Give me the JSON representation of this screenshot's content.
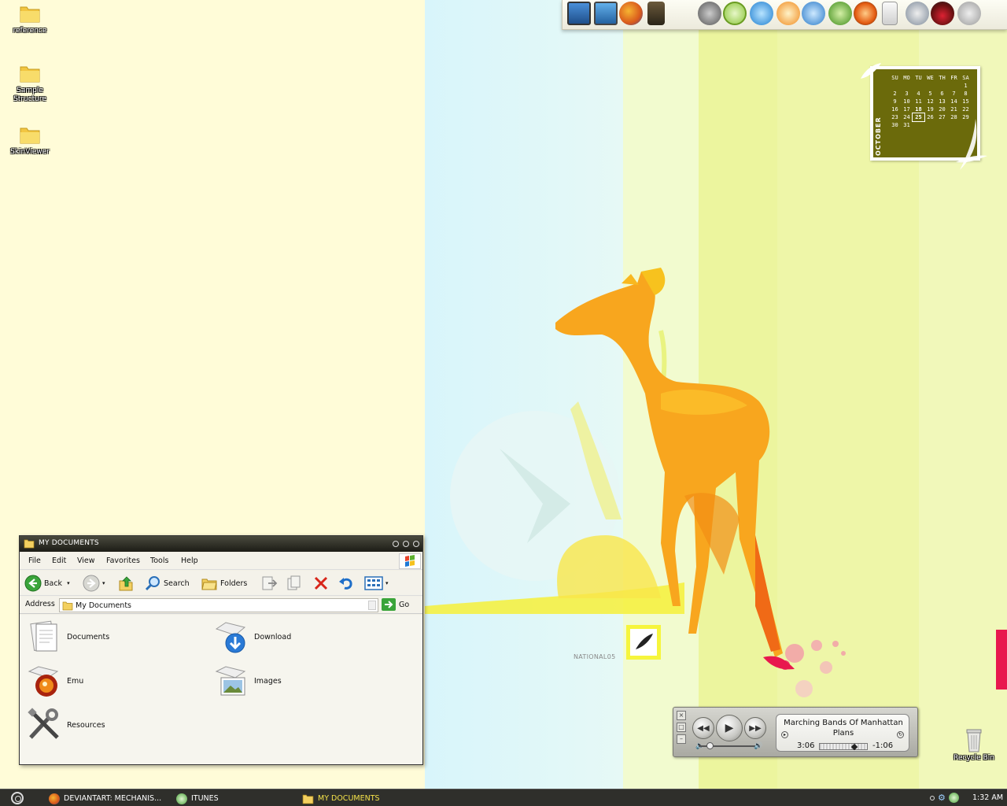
{
  "desktop": {
    "icons": [
      {
        "label": "reference",
        "icon": "folder-icon"
      },
      {
        "label": "Sample Structure",
        "icon": "folder-icon"
      },
      {
        "label": "SkinViewer",
        "icon": "folder-icon"
      }
    ],
    "recycle_bin": {
      "label": "Recycle Bin",
      "icon": "recycle-bin-icon"
    },
    "wallpaper_text": "NATIONAL05",
    "colors": {
      "left": "#fffcd8",
      "blue": "#d8f5fb",
      "yellow": "#ecf59e",
      "deer": "#f7a61a",
      "accent": "#e8184e"
    }
  },
  "dock": {
    "items": [
      "my-computer-icon",
      "network-icon",
      "firefox-icon",
      "character-icon",
      "headphones-icon",
      "dreamweaver-icon",
      "vegas-icon",
      "mail-icon",
      "winamp-icon",
      "tree-icon",
      "half-life-icon",
      "ipod-icon",
      "tools-icon",
      "mask-icon",
      "gear-icon"
    ]
  },
  "calendar": {
    "month": "OCTOBER",
    "days": [
      "SU",
      "MO",
      "TU",
      "WE",
      "TH",
      "FR",
      "SA"
    ],
    "weeks": [
      [
        "",
        "",
        "",
        "",
        "",
        "",
        "1"
      ],
      [
        "2",
        "3",
        "4",
        "5",
        "6",
        "7",
        "8"
      ],
      [
        "9",
        "10",
        "11",
        "12",
        "13",
        "14",
        "15"
      ],
      [
        "16",
        "17",
        "18",
        "19",
        "20",
        "21",
        "22"
      ],
      [
        "23",
        "24",
        "25",
        "26",
        "27",
        "28",
        "29"
      ],
      [
        "30",
        "31",
        "",
        "",
        "",
        "",
        ""
      ]
    ],
    "today": "25",
    "bold": "18"
  },
  "explorer": {
    "title": "MY DOCUMENTS",
    "menu": [
      "File",
      "Edit",
      "View",
      "Favorites",
      "Tools",
      "Help"
    ],
    "toolbar": {
      "back": "Back",
      "search": "Search",
      "folders": "Folders"
    },
    "address_label": "Address",
    "address_value": "My Documents",
    "go_label": "Go",
    "items": [
      {
        "label": "Documents",
        "icon": "documents-icon"
      },
      {
        "label": "Download",
        "icon": "download-icon"
      },
      {
        "label": "Emu",
        "icon": "emu-icon"
      },
      {
        "label": "Images",
        "icon": "images-icon"
      },
      {
        "label": "Resources",
        "icon": "tools-icon"
      }
    ]
  },
  "player": {
    "track_line1": "Marching Bands Of Manhattan",
    "track_line2": "Plans",
    "elapsed": "3:06",
    "remaining": "-1:06",
    "progress": 0.74
  },
  "taskbar": {
    "tasks": [
      {
        "label": "DEVIANTART: MECHANIS...",
        "icon": "firefox-icon",
        "active": false
      },
      {
        "label": "ITUNES",
        "icon": "itunes-icon",
        "active": false
      },
      {
        "label": "MY DOCUMENTS",
        "icon": "folder-icon",
        "active": true
      }
    ],
    "clock": "1:32 AM"
  }
}
